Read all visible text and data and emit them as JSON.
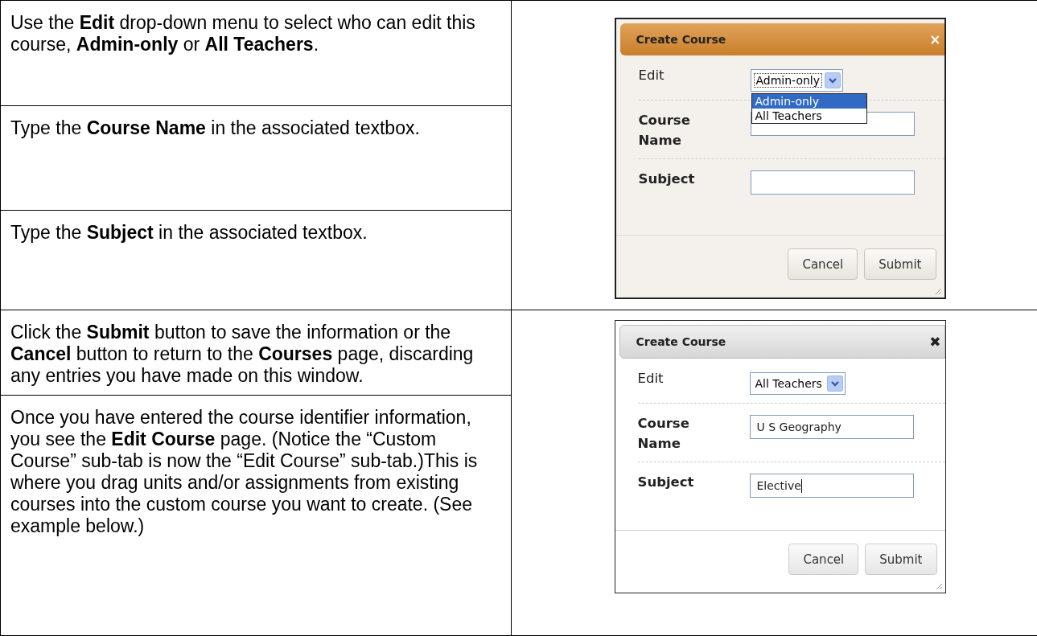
{
  "sections": [
    {
      "instructions": [
        "Use the **Edit** drop-down menu to select who can edit this course, **Admin-only** or **All Teachers**.",
        "Type the **Course Name** in the associated textbox.",
        "Type the **Subject** in the associated textbox."
      ],
      "dialog": {
        "title": "Create Course",
        "kind": "orange",
        "close": "×",
        "edit_label": "Edit",
        "edit_value": "Admin-only",
        "dropdown_open": true,
        "options": [
          {
            "label": "Admin-only",
            "selected": true
          },
          {
            "label": "All Teachers",
            "selected": false
          }
        ],
        "name_label": "Course Name",
        "subject_label": "Subject",
        "caret": false,
        "buttons": [
          "Cancel",
          "Submit"
        ]
      }
    },
    {
      "instructions": [
        "Click the **Submit** button to save the information or the **Cancel** button to return to the **Courses** page, discarding any entries you have made on this window.",
        "Once you have entered the course identifier information, you see the **Edit Course** page. (Notice the “Custom Course” sub-tab is now the “Edit Course” sub-tab.)This is where you drag units and/or assignments from existing courses into the custom course you want to create. (See example below.)"
      ],
      "dialog": {
        "title": "Create Course",
        "kind": "grey",
        "close": "✖",
        "edit_label": "Edit",
        "edit_value": "All Teachers",
        "dropdown_open": false,
        "name_label": "Course Name",
        "name_value": "U S Geography",
        "subject_label": "Subject",
        "subject_value": "Elective",
        "caret": true,
        "buttons": [
          "Cancel",
          "Submit"
        ]
      }
    }
  ]
}
